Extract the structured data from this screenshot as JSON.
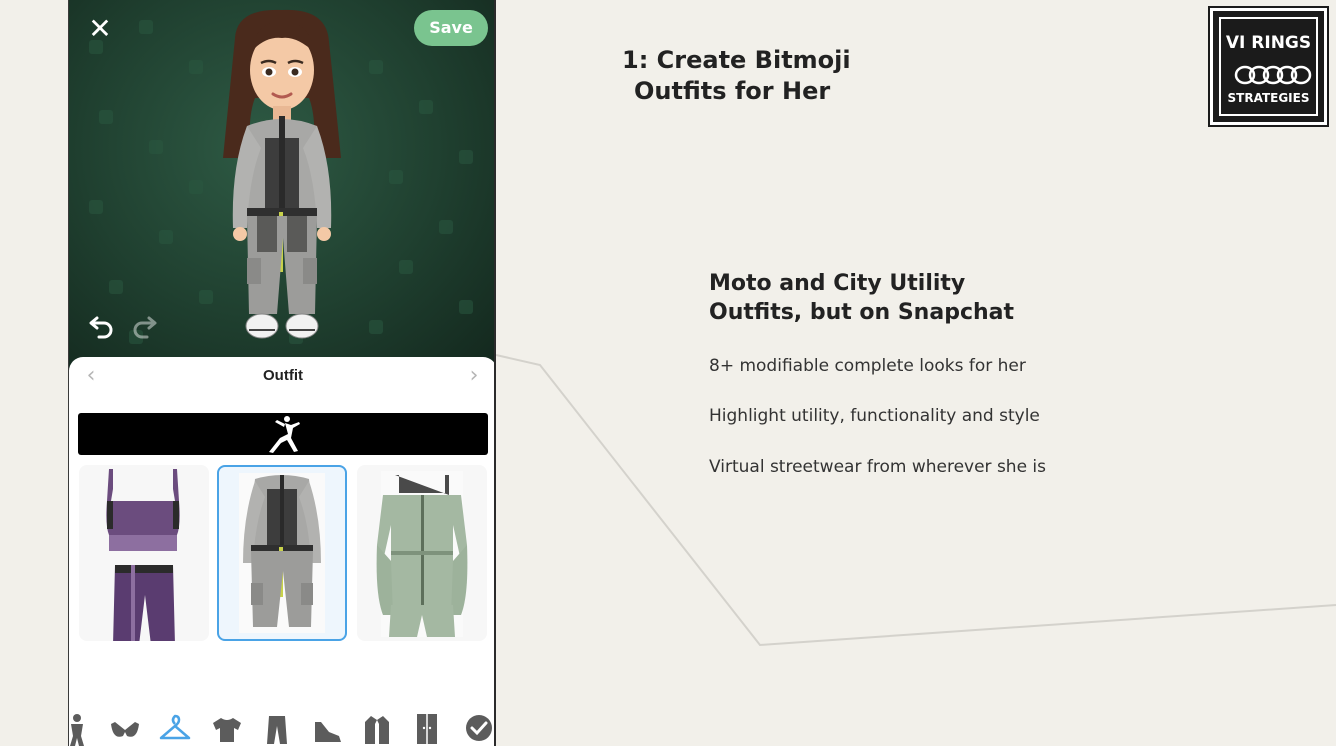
{
  "slide": {
    "title_line1": "1: Create Bitmoji",
    "title_line2": "Outfits for Her",
    "subheading_line1": "Moto and City Utility",
    "subheading_line2": "Outfits, but on Snapchat",
    "bullets": [
      "8+ modifiable complete looks for her",
      "Highlight utility, functionality and style",
      "Virtual streetwear from wherever she is"
    ],
    "logo": {
      "line1": "VI RINGS",
      "line3": "STRATEGIES"
    }
  },
  "phone": {
    "close_icon": "close-icon",
    "save_label": "Save",
    "undo_icon": "undo-icon",
    "redo_icon": "redo-icon",
    "sheet": {
      "title": "Outfit",
      "prev_icon": "chevron-left-icon",
      "next_icon": "chevron-right-icon",
      "brand_logo": "jumpman-logo",
      "outfits": [
        {
          "name": "purple-crop-top-and-bike-shorts",
          "selected": false
        },
        {
          "name": "grey-utility-jumpsuit",
          "selected": true
        },
        {
          "name": "sage-off-shoulder-romper",
          "selected": false
        }
      ],
      "categories": [
        {
          "icon": "body-icon"
        },
        {
          "icon": "bra-icon"
        },
        {
          "icon": "hanger-icon",
          "active": true
        },
        {
          "icon": "tshirt-icon"
        },
        {
          "icon": "pants-icon"
        },
        {
          "icon": "sneaker-icon"
        },
        {
          "icon": "jacket-icon"
        },
        {
          "icon": "closet-icon"
        },
        {
          "icon": "checkmark-icon"
        }
      ]
    }
  },
  "colors": {
    "background": "#f2f0ea",
    "save_button": "#7ac48f",
    "selected_border": "#4aa3e6",
    "active_category": "#4aa3e6",
    "stage_green": "#2e5a44"
  }
}
